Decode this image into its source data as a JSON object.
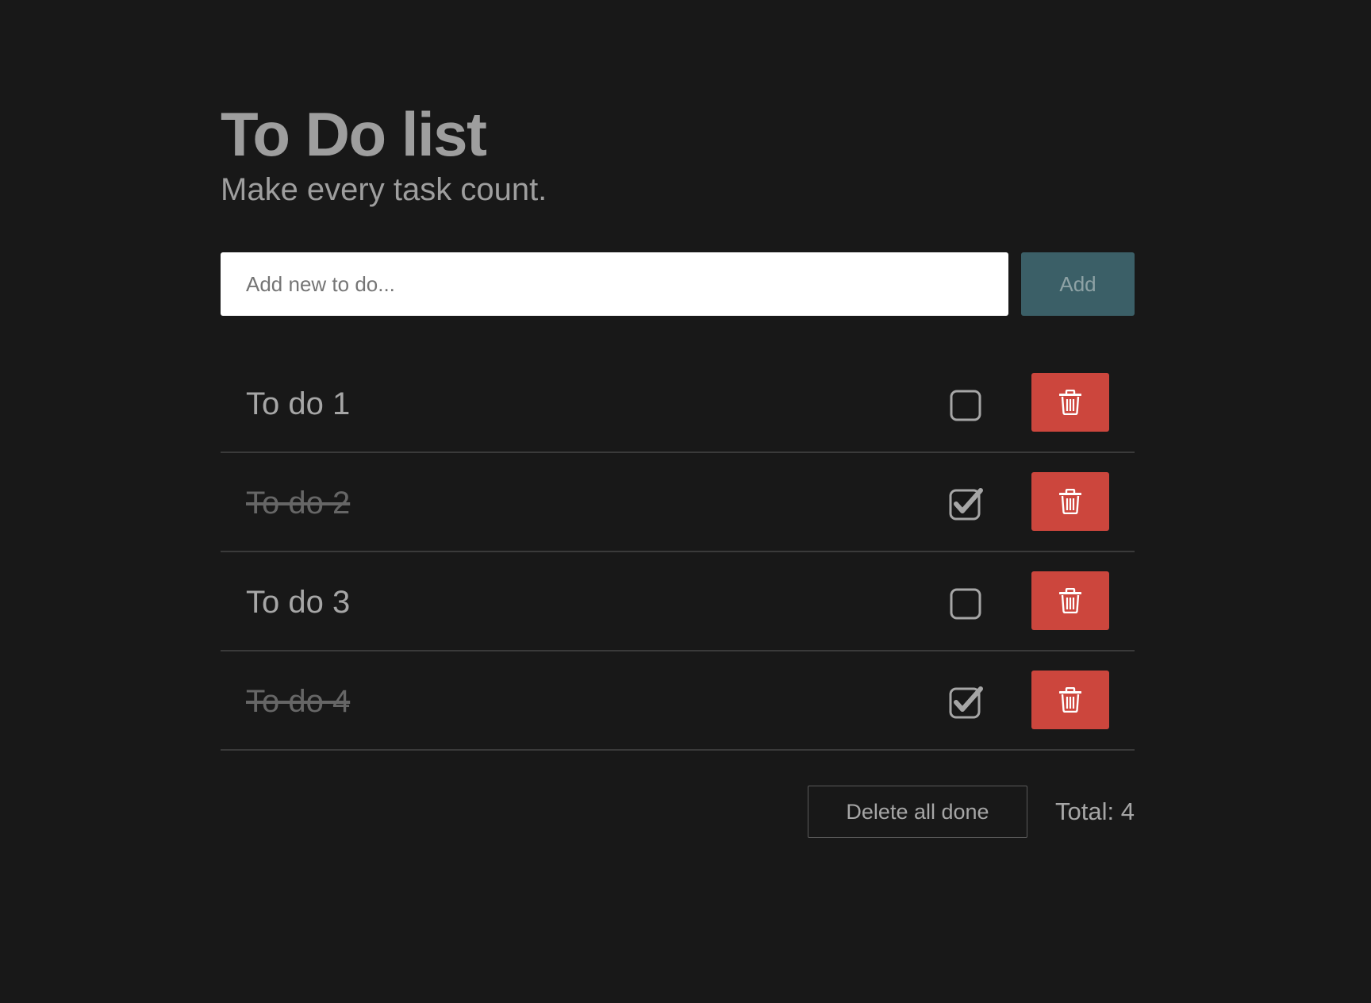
{
  "header": {
    "title": "To Do list",
    "subtitle": "Make every task count."
  },
  "add_form": {
    "placeholder": "Add new to do...",
    "value": "",
    "add_label": "Add"
  },
  "todos": [
    {
      "text": "To do 1",
      "done": false
    },
    {
      "text": "To do 2",
      "done": true
    },
    {
      "text": "To do 3",
      "done": false
    },
    {
      "text": "To do 4",
      "done": true
    }
  ],
  "footer": {
    "delete_done_label": "Delete all done",
    "total_label": "Total: 4"
  },
  "colors": {
    "background": "#181818",
    "text": "#a6a6a6",
    "done_text": "#666666",
    "add_button": "#3b5f67",
    "delete_button": "#cc463d",
    "input_background": "#ffffff"
  },
  "icons": {
    "checkbox_unchecked": "square-icon",
    "checkbox_checked": "check-square-icon",
    "delete": "trash-icon"
  }
}
